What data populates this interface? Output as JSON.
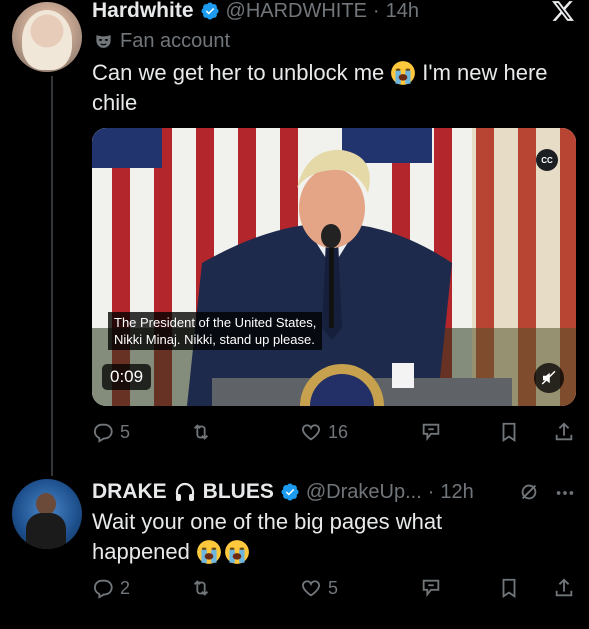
{
  "tweet1": {
    "display_name": "Hardwhite",
    "handle": "@HARDWHITE",
    "dot": "·",
    "time": "14h",
    "fan_label": "Fan account",
    "text_line1": "Can we get her to unblock me",
    "text_line1_suffix": "I'm new here",
    "text_line2": "chile",
    "video": {
      "caption_line1": "The President of the United States,",
      "caption_line2": "Nikki Minaj. Nikki, stand up please.",
      "duration": "0:09",
      "cc_label": "CC"
    },
    "actions": {
      "replies": "5",
      "likes": "16"
    }
  },
  "tweet2": {
    "display_name_part1": "DRAKE",
    "display_name_part2": "BLUES",
    "handle": "@DrakeUp...",
    "dot": "·",
    "time": "12h",
    "text_line1": "Wait your one of the big pages what",
    "text_line2": "happened",
    "actions": {
      "replies": "2",
      "likes": "5"
    }
  },
  "colors": {
    "background": "#000000",
    "text": "#e7e9ea",
    "muted": "#71767b",
    "verified": "#1d9bf0",
    "thread_line": "#333639"
  },
  "icons": [
    "verified-badge-icon",
    "x-logo-icon",
    "mask-icon",
    "loudly-crying-emoji",
    "cc-icon",
    "mute-icon",
    "reply-icon",
    "retweet-icon",
    "like-icon",
    "grok-icon",
    "bookmark-icon",
    "share-icon",
    "more-icon",
    "headphones-icon",
    "undo-icon"
  ]
}
